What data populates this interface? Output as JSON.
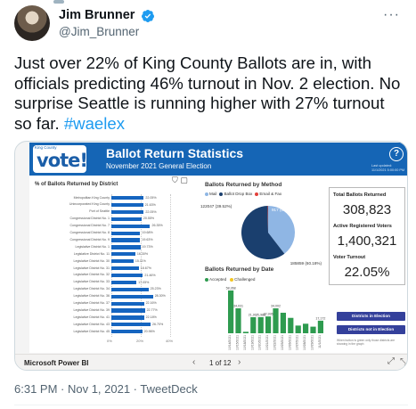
{
  "tweet": {
    "author_name": "Jim Brunner",
    "handle": "@Jim_Brunner",
    "text": "Just over 22% of King County Ballots are in, with officials predicting 46% turnout in Nov. 2 election. No surprise Seattle is running higher with 27% turnout so far. ",
    "hashtag": "#waelex",
    "timestamp": "6:31 PM · Nov 1, 2021 · TweetDeck",
    "more_icon": "more-dots-icon",
    "verified_icon": "verified-badge-icon"
  },
  "report": {
    "logo_small": "King County",
    "logo_big": "vote!",
    "title": "Ballot Return Statistics",
    "subtitle": "November 2021 General Election",
    "help_glyph": "?",
    "last_updated": "Last updated: 11/1/2021 5:00:00 PM"
  },
  "chart_data": [
    {
      "type": "bar",
      "orientation": "horizontal",
      "title": "% of Ballots Returned by District",
      "categories": [
        "Metropolitan King County",
        "Unincorporated King County",
        "Port of Seattle",
        "Congressional District No. 1",
        "Congressional District No. 7",
        "Congressional District No. 8",
        "Congressional District No. 9",
        "Legislative District No. 1",
        "Legislative District No. 11",
        "Legislative District No. 30",
        "Legislative District No. 31",
        "Legislative District No. 32",
        "Legislative District No. 33",
        "Legislative District No. 34",
        "Legislative District No. 36",
        "Legislative District No. 37",
        "Legislative District No. 39",
        "Legislative District No. 41",
        "Legislative District No. 43",
        "Legislative District No. 45"
      ],
      "values": [
        22.05,
        21.63,
        22.05,
        20.55,
        26.35,
        19.68,
        19.63,
        19.73,
        16.3,
        15.11,
        18.67,
        21.46,
        17.05,
        25.23,
        28.3,
        22.16,
        22.77,
        22.18,
        26.7,
        20.96
      ],
      "xlim": [
        0,
        40
      ],
      "xticks": [
        "0%",
        "20%",
        "40%"
      ]
    },
    {
      "type": "pie",
      "title": "Ballots Returned by Method",
      "legend": [
        "Mail",
        "Ballot Drop Box",
        "Email & Fax"
      ],
      "slices": [
        {
          "label": "Mail",
          "value": 122047,
          "percent": "39.52%",
          "color": "#8fb6e4"
        },
        {
          "label": "Ballot Drop Box",
          "value": 185859,
          "percent": "60.18%",
          "color": "#1a3f6e"
        },
        {
          "label": "Email & Fax",
          "value": 917,
          "percent": "0.30%",
          "color": "#e2403a"
        }
      ],
      "slice_labels": [
        "122047 (39.52%)",
        "917 (0.30%)",
        "185859 (60.18%)"
      ]
    },
    {
      "type": "bar",
      "title": "Ballots Returned by Date",
      "legend": [
        "Accepted",
        "Challenged"
      ],
      "colors": {
        "accepted": "#2e9b4f",
        "challenged": "#f3c623"
      },
      "categories": [
        "10/14/2021",
        "10/15/2021",
        "10/18/2021",
        "10/19/2021",
        "10/20/2021",
        "10/21/2021",
        "10/22/2021",
        "10/25/2021",
        "10/26/2021",
        "10/27/2021",
        "10/28/2021",
        "10/29/2021",
        "11/1/2021"
      ],
      "series": [
        {
          "name": "Accepted",
          "values": [
            58368,
            34031,
            2000,
            21917,
            21988,
            22936,
            34002,
            28000,
            21000,
            10500,
            13000,
            9000,
            17172
          ]
        }
      ],
      "data_labels": [
        "58,368",
        "34,031",
        "",
        "21,917",
        "21,988",
        "22,936",
        "34,002",
        "",
        "",
        "",
        "",
        "",
        "17,172"
      ]
    }
  ],
  "kpis": {
    "total_label": "Total Ballots Returned",
    "total_value": "308,823",
    "registered_label": "Active Registered Voters",
    "registered_value": "1,400,321",
    "turnout_label": "Voter Turnout",
    "turnout_value": "22.05%"
  },
  "buttons": {
    "in_election": "Districts in Election",
    "not_in_election": "Districts not in Election",
    "note": "When button is green only those districts are showing in the graph"
  },
  "powerbi": {
    "label": "Microsoft Power BI",
    "page": "1 of 12",
    "prev_icon": "chevron-left-icon",
    "next_icon": "chevron-right-icon",
    "share_icon": "share-icon",
    "expand_icon": "expand-icon"
  }
}
